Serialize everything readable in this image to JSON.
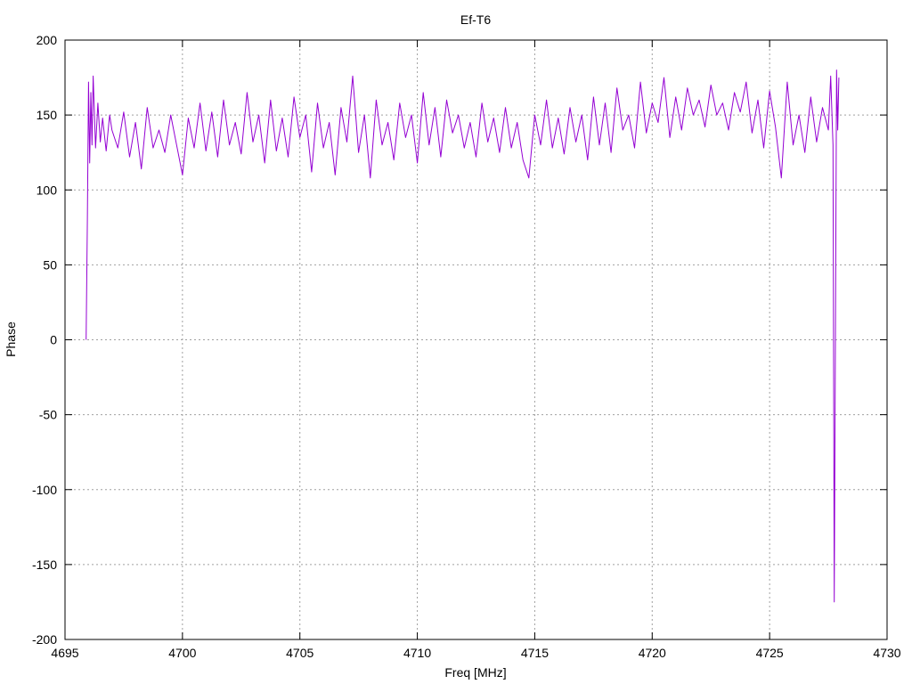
{
  "chart_data": {
    "type": "line",
    "title": "Ef-T6",
    "xlabel": "Freq [MHz]",
    "ylabel": "Phase",
    "xlim": [
      4695,
      4730
    ],
    "ylim": [
      -200,
      200
    ],
    "xticks": [
      4695,
      4700,
      4705,
      4710,
      4715,
      4720,
      4725,
      4730
    ],
    "yticks": [
      -200,
      -150,
      -100,
      -50,
      0,
      50,
      100,
      150,
      200
    ],
    "grid": true,
    "legend": "none",
    "series_color": "#9400d3",
    "series": [
      {
        "x": [
          4695.9,
          4695.95,
          4696.0,
          4696.05,
          4696.1,
          4696.15,
          4696.2,
          4696.3,
          4696.4,
          4696.5,
          4696.6,
          4696.75,
          4696.9,
          4697.0,
          4697.25,
          4697.5,
          4697.75,
          4698.0,
          4698.25,
          4698.5,
          4698.75,
          4699.0,
          4699.25,
          4699.5,
          4699.75,
          4700.0,
          4700.25,
          4700.5,
          4700.75,
          4701.0,
          4701.25,
          4701.5,
          4701.75,
          4702.0,
          4702.25,
          4702.5,
          4702.75,
          4703.0,
          4703.25,
          4703.5,
          4703.75,
          4704.0,
          4704.25,
          4704.5,
          4704.75,
          4705.0,
          4705.25,
          4705.5,
          4705.75,
          4706.0,
          4706.25,
          4706.5,
          4706.75,
          4707.0,
          4707.25,
          4707.5,
          4707.75,
          4708.0,
          4708.25,
          4708.5,
          4708.75,
          4709.0,
          4709.25,
          4709.5,
          4709.75,
          4710.0,
          4710.25,
          4710.5,
          4710.75,
          4711.0,
          4711.25,
          4711.5,
          4711.75,
          4712.0,
          4712.25,
          4712.5,
          4712.75,
          4713.0,
          4713.25,
          4713.5,
          4713.75,
          4714.0,
          4714.25,
          4714.5,
          4714.75,
          4715.0,
          4715.25,
          4715.5,
          4715.75,
          4716.0,
          4716.25,
          4716.5,
          4716.75,
          4717.0,
          4717.25,
          4717.5,
          4717.75,
          4718.0,
          4718.25,
          4718.5,
          4718.75,
          4719.0,
          4719.25,
          4719.5,
          4719.75,
          4720.0,
          4720.25,
          4720.5,
          4720.75,
          4721.0,
          4721.25,
          4721.5,
          4721.75,
          4722.0,
          4722.25,
          4722.5,
          4722.75,
          4723.0,
          4723.25,
          4723.5,
          4723.75,
          4724.0,
          4724.25,
          4724.5,
          4724.75,
          4725.0,
          4725.25,
          4725.5,
          4725.75,
          4726.0,
          4726.25,
          4726.5,
          4726.75,
          4727.0,
          4727.25,
          4727.5,
          4727.6,
          4727.7,
          4727.75,
          4727.8,
          4727.85,
          4727.9,
          4727.95
        ],
        "y": [
          0,
          80,
          172,
          118,
          165,
          130,
          176,
          128,
          158,
          132,
          148,
          126,
          150,
          140,
          128,
          152,
          122,
          145,
          114,
          155,
          128,
          140,
          125,
          150,
          130,
          110,
          148,
          128,
          158,
          126,
          152,
          122,
          160,
          130,
          145,
          124,
          165,
          132,
          150,
          118,
          160,
          126,
          148,
          122,
          162,
          135,
          150,
          112,
          158,
          128,
          145,
          110,
          155,
          132,
          176,
          125,
          150,
          108,
          160,
          130,
          145,
          120,
          158,
          135,
          150,
          118,
          165,
          130,
          155,
          122,
          160,
          138,
          150,
          128,
          145,
          122,
          158,
          132,
          148,
          125,
          155,
          128,
          145,
          120,
          108,
          150,
          130,
          160,
          128,
          148,
          124,
          155,
          132,
          150,
          120,
          162,
          130,
          158,
          125,
          168,
          140,
          150,
          128,
          172,
          138,
          158,
          145,
          175,
          135,
          162,
          140,
          168,
          150,
          160,
          142,
          170,
          150,
          158,
          140,
          165,
          152,
          172,
          138,
          160,
          128,
          166,
          142,
          108,
          172,
          130,
          150,
          125,
          162,
          132,
          155,
          140,
          176,
          130,
          -175,
          0,
          180,
          140,
          175
        ]
      }
    ]
  }
}
